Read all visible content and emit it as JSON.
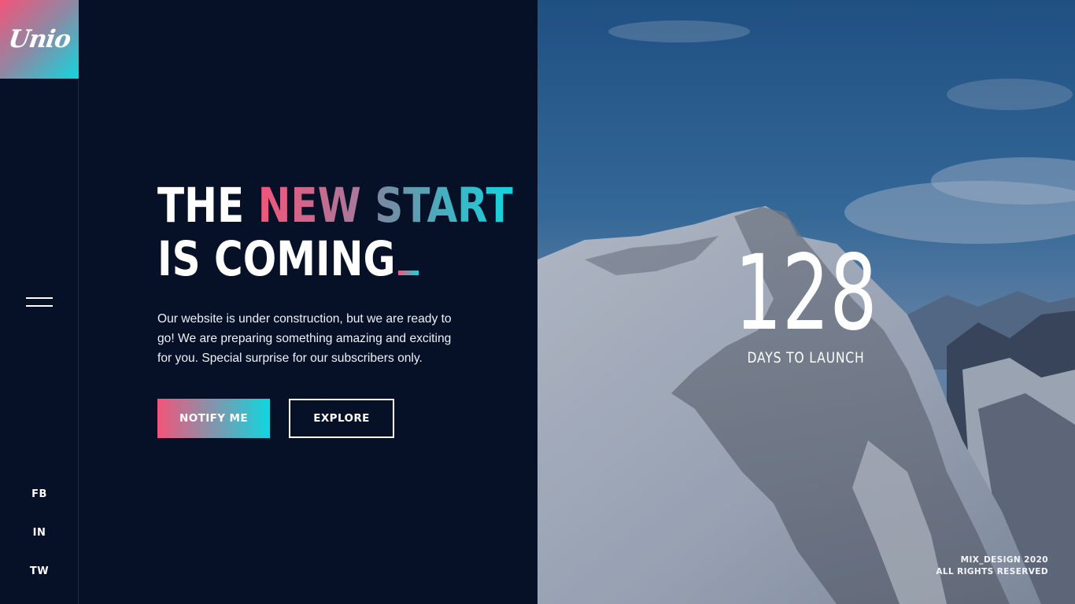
{
  "brand": {
    "logo_text": "Unio"
  },
  "sidebar": {
    "menu_icon": "hamburger-menu-icon",
    "social": [
      {
        "label": "FB"
      },
      {
        "label": "IN"
      },
      {
        "label": "TW"
      }
    ]
  },
  "headline": {
    "word_the": "THE ",
    "word_new": "NEW",
    "word_start": "START",
    "line2": "IS COMING"
  },
  "description": "Our website is under construction, but we are ready to go! We are preparing something amazing and exciting for you. Special surprise for our subscribers only.",
  "buttons": {
    "notify": "NOTIFY ME",
    "explore": "EXPLORE"
  },
  "countdown": {
    "value": "128",
    "label": "DAYS TO LAUNCH"
  },
  "footer": {
    "line1": "MIX_DESIGN 2020",
    "line2": "ALL RIGHTS RESERVED"
  },
  "colors": {
    "background": "#061027",
    "accent_pink": "#f2557a",
    "accent_cyan": "#10d6df"
  }
}
